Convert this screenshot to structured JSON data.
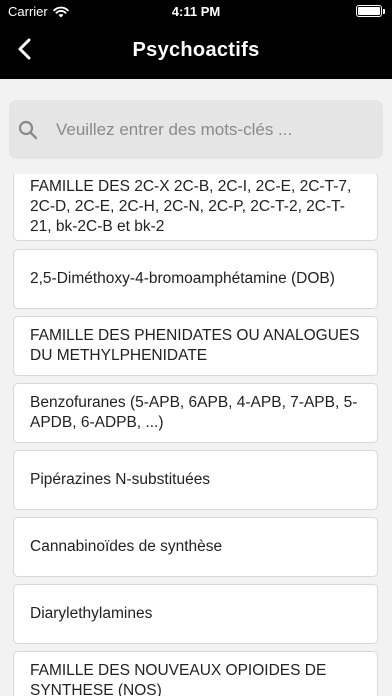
{
  "status_bar": {
    "carrier": "Carrier",
    "time": "4:11 PM"
  },
  "nav": {
    "title": "Psychoactifs"
  },
  "search": {
    "placeholder": "Veuillez entrer des mots-clés ..."
  },
  "list": {
    "items": [
      {
        "label": "FAMILLE DES 2C-X 2C-B, 2C-I, 2C-E, 2C-T-7, 2C-D, 2C-E, 2C-H, 2C-N, 2C-P, 2C-T-2, 2C-T-21, bk-2C-B et bk-2"
      },
      {
        "label": "2,5-Diméthoxy-4-bromoamphétamine (DOB)"
      },
      {
        "label": "FAMILLE DES PHENIDATES OU ANALOGUES DU METHYLPHENIDATE"
      },
      {
        "label": "Benzofuranes (5-APB, 6APB, 4-APB, 7-APB, 5-APDB, 6-ADPB, ...)"
      },
      {
        "label": "Pipérazines N-substituées"
      },
      {
        "label": "Cannabinoïdes de synthèse"
      },
      {
        "label": "Diarylethylamines"
      },
      {
        "label": "FAMILLE DES NOUVEAUX OPIOIDES DE SYNTHESE (NOS)"
      }
    ]
  }
}
